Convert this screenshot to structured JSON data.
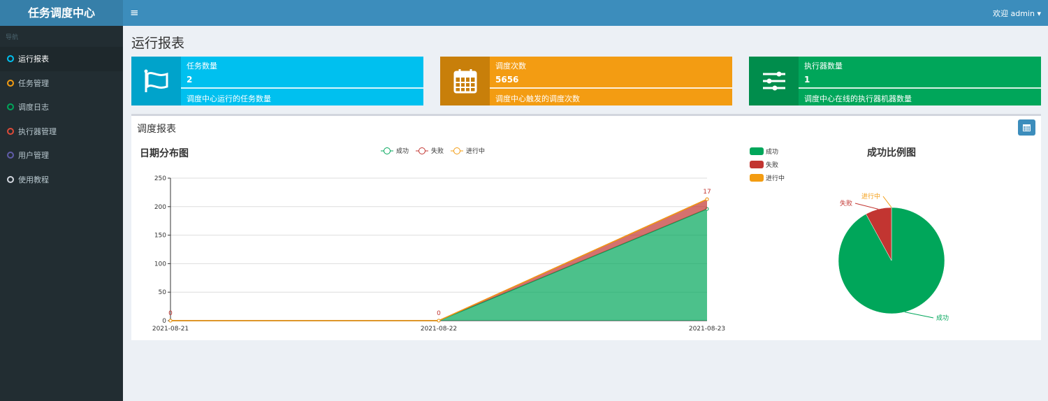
{
  "app": {
    "title": "任务调度中心",
    "user": "欢迎 admin"
  },
  "sidebar": {
    "header": "导航",
    "items": [
      {
        "label": "运行报表",
        "color": "#00c0ef",
        "active": true
      },
      {
        "label": "任务管理",
        "color": "#f39c12"
      },
      {
        "label": "调度日志",
        "color": "#00a65a"
      },
      {
        "label": "执行器管理",
        "color": "#dd4b39"
      },
      {
        "label": "用户管理",
        "color": "#605ca8"
      },
      {
        "label": "使用教程",
        "color": "#d2d6de"
      }
    ]
  },
  "page": {
    "title": "运行报表"
  },
  "info_boxes": [
    {
      "label": "任务数量",
      "value": "2",
      "desc": "调度中心运行的任务数量",
      "icon": "flag-icon",
      "color": "#00c0ef",
      "dark": "#00a3cb"
    },
    {
      "label": "调度次数",
      "value": "5656",
      "desc": "调度中心触发的调度次数",
      "icon": "calendar-icon",
      "color": "#f39c12",
      "dark": "#c87f0a"
    },
    {
      "label": "执行器数量",
      "value": "1",
      "desc": "调度中心在线的执行器机器数量",
      "icon": "sliders-icon",
      "color": "#00a65a",
      "dark": "#008d4c"
    }
  ],
  "report": {
    "title": "调度报表"
  },
  "chart_data": [
    {
      "type": "area",
      "title": "日期分布图",
      "stacked": true,
      "categories": [
        "2021-08-21",
        "2021-08-22",
        "2021-08-23"
      ],
      "ylim": [
        0,
        250
      ],
      "yticks": [
        0,
        50,
        100,
        150,
        200,
        250
      ],
      "grid": true,
      "legend": "top-center",
      "series": [
        {
          "name": "成功",
          "values": [
            0,
            0,
            196
          ],
          "color": "#00a65a"
        },
        {
          "name": "失败",
          "values": [
            0,
            0,
            17
          ],
          "color": "#c23531"
        },
        {
          "name": "进行中",
          "values": [
            0,
            0,
            0
          ],
          "color": "#f39c12"
        }
      ],
      "data_labels": [
        "0",
        "0",
        "17"
      ]
    },
    {
      "type": "pie",
      "title": "成功比例图",
      "legend": "top-left",
      "slices": [
        {
          "name": "成功",
          "value": 196,
          "color": "#00a65a"
        },
        {
          "name": "失败",
          "value": 17,
          "color": "#c23531"
        },
        {
          "name": "进行中",
          "value": 0,
          "color": "#f39c12"
        }
      ]
    }
  ]
}
